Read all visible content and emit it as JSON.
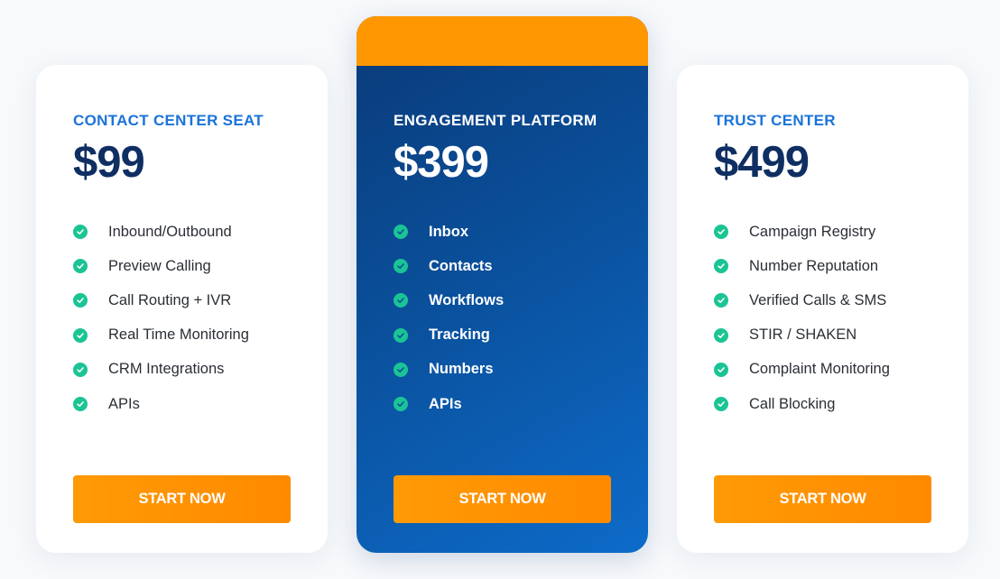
{
  "colors": {
    "accent_orange": "#ff9800",
    "plan_name_blue": "#1a73d9",
    "price_navy": "#0f2f63",
    "check_green": "#1bc495",
    "featured_bg_start": "#0a3a78",
    "featured_bg_end": "#0d6bc9"
  },
  "plans": [
    {
      "name": "CONTACT CENTER SEAT",
      "price": "$99",
      "featured": false,
      "features": [
        "Inbound/Outbound",
        "Preview Calling",
        "Call Routing + IVR",
        "Real Time Monitoring",
        "CRM Integrations",
        "APIs"
      ],
      "cta": "START NOW",
      "feature_icon": "check-circle-icon"
    },
    {
      "name": "ENGAGEMENT PLATFORM",
      "price": "$399",
      "featured": true,
      "features": [
        "Inbox",
        "Contacts",
        "Workflows",
        "Tracking",
        "Numbers",
        "APIs"
      ],
      "cta": "START NOW",
      "feature_icon": "check-circle-icon"
    },
    {
      "name": "TRUST CENTER",
      "price": "$499",
      "featured": false,
      "features": [
        "Campaign Registry",
        "Number Reputation",
        "Verified Calls & SMS",
        "STIR / SHAKEN",
        "Complaint Monitoring",
        "Call Blocking"
      ],
      "cta": "START NOW",
      "feature_icon": "check-circle-icon"
    }
  ]
}
